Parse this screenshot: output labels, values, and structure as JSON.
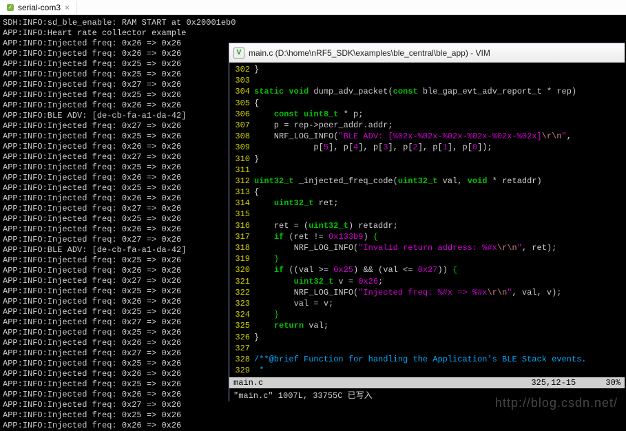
{
  "tab": {
    "title": "serial-com3",
    "close": "×"
  },
  "terminal": {
    "lines": [
      "SDH:INFO:sd_ble_enable: RAM START at 0x20001eb0",
      "APP:INFO:Heart rate collector example",
      "APP:INFO:Injected freq: 0x26 => 0x26",
      "APP:INFO:Injected freq: 0x26 => 0x26",
      "APP:INFO:Injected freq: 0x25 => 0x26",
      "APP:INFO:Injected freq: 0x25 => 0x26",
      "APP:INFO:Injected freq: 0x27 => 0x26",
      "APP:INFO:Injected freq: 0x25 => 0x26",
      "APP:INFO:Injected freq: 0x26 => 0x26",
      "APP:INFO:BLE ADV: [de-cb-fa-a1-da-42]",
      "APP:INFO:Injected freq: 0x27 => 0x26",
      "APP:INFO:Injected freq: 0x25 => 0x26",
      "APP:INFO:Injected freq: 0x26 => 0x26",
      "APP:INFO:Injected freq: 0x27 => 0x26",
      "APP:INFO:Injected freq: 0x25 => 0x26",
      "APP:INFO:Injected freq: 0x26 => 0x26",
      "APP:INFO:Injected freq: 0x25 => 0x26",
      "APP:INFO:Injected freq: 0x26 => 0x26",
      "APP:INFO:Injected freq: 0x27 => 0x26",
      "APP:INFO:Injected freq: 0x25 => 0x26",
      "APP:INFO:Injected freq: 0x26 => 0x26",
      "APP:INFO:Injected freq: 0x27 => 0x26",
      "APP:INFO:BLE ADV: [de-cb-fa-a1-da-42]",
      "APP:INFO:Injected freq: 0x25 => 0x26",
      "APP:INFO:Injected freq: 0x26 => 0x26",
      "APP:INFO:Injected freq: 0x27 => 0x26",
      "APP:INFO:Injected freq: 0x25 => 0x26",
      "APP:INFO:Injected freq: 0x26 => 0x26",
      "APP:INFO:Injected freq: 0x25 => 0x26",
      "APP:INFO:Injected freq: 0x27 => 0x26",
      "APP:INFO:Injected freq: 0x25 => 0x26",
      "APP:INFO:Injected freq: 0x26 => 0x26",
      "APP:INFO:Injected freq: 0x27 => 0x26",
      "APP:INFO:Injected freq: 0x25 => 0x26",
      "APP:INFO:Injected freq: 0x26 => 0x26",
      "APP:INFO:Injected freq: 0x25 => 0x26",
      "APP:INFO:Injected freq: 0x26 => 0x26",
      "APP:INFO:Injected freq: 0x27 => 0x26",
      "APP:INFO:Injected freq: 0x25 => 0x26",
      "APP:INFO:Injected freq: 0x26 => 0x26"
    ]
  },
  "vim": {
    "title": "main.c (D:\\home\\nRF5_SDK\\examples\\ble_central\\ble_app) - VIM",
    "status_left": "main.c",
    "status_pos": "325,12-15",
    "status_pct": "30%",
    "cmdline": "\"main.c\" 1007L, 33755C 已写入",
    "lines": [
      {
        "n": 302,
        "html": "}"
      },
      {
        "n": 303,
        "html": ""
      },
      {
        "n": 304,
        "html": "<span class='kw'>static</span> <span class='kw'>void</span> dump_adv_packet(<span class='kw'>const</span> ble_gap_evt_adv_report_t * rep)"
      },
      {
        "n": 305,
        "html": "{"
      },
      {
        "n": 306,
        "html": "    <span class='kw'>const</span> <span class='type'>uint8_t</span> * p;"
      },
      {
        "n": 307,
        "html": "    p = rep-&gt;peer_addr.addr;"
      },
      {
        "n": 308,
        "html": "    NRF_LOG_INFO(<span class='str'>\"BLE ADV: [%02x-%02x-%02x-%02x-%02x-%02x]</span><span class='esc'>\\r\\n</span><span class='str'>\"</span>,"
      },
      {
        "n": 309,
        "html": "            p[<span class='num'>5</span>], p[<span class='num'>4</span>], p[<span class='num'>3</span>], p[<span class='num'>2</span>], p[<span class='num'>1</span>], p[<span class='num'>0</span>]);"
      },
      {
        "n": 310,
        "html": "}"
      },
      {
        "n": 311,
        "html": ""
      },
      {
        "n": 312,
        "html": "<span class='type'>uint32_t</span> _injected_freq_code(<span class='type'>uint32_t</span> val, <span class='kw'>void</span> * retaddr)"
      },
      {
        "n": 313,
        "html": "{"
      },
      {
        "n": 314,
        "html": "    <span class='type'>uint32_t</span> ret;"
      },
      {
        "n": 315,
        "html": ""
      },
      {
        "n": 316,
        "html": "    ret = (<span class='type'>uint32_t</span>) retaddr;"
      },
      {
        "n": 317,
        "html": "    <span class='kw'>if</span> (ret != <span class='num'>0x133b9</span>) <span class='br'>{</span>"
      },
      {
        "n": 318,
        "html": "        NRF_LOG_INFO(<span class='str'>\"Invalid return address: %#x</span><span class='esc'>\\r\\n</span><span class='str'>\"</span>, ret);"
      },
      {
        "n": 319,
        "html": "    <span class='br'>}</span>"
      },
      {
        "n": 320,
        "html": "    <span class='kw'>if</span> ((val &gt;= <span class='num'>0x25</span>) &amp;&amp; (val &lt;= <span class='num'>0x27</span>)) <span class='br'>{</span>"
      },
      {
        "n": 321,
        "html": "        <span class='type'>uint32_t</span> v = <span class='num'>0x26</span>;"
      },
      {
        "n": 322,
        "html": "        NRF_LOG_INFO(<span class='str'>\"Injected freq: %#x =&gt; %#x</span><span class='esc'>\\r\\n</span><span class='str'>\"</span>, val, v);"
      },
      {
        "n": 323,
        "html": "        val = v;"
      },
      {
        "n": 324,
        "html": "    <span class='br'>}</span>"
      },
      {
        "n": 325,
        "html": "    <span class='kw'>return</span> val;"
      },
      {
        "n": 326,
        "html": "}"
      },
      {
        "n": 327,
        "html": ""
      },
      {
        "n": 328,
        "html": "<span class='cmt'>/**@brief Function for handling the Application's BLE Stack events.</span>"
      },
      {
        "n": 329,
        "html": "<span class='cmt'> *</span>"
      }
    ]
  },
  "watermark": "http://blog.csdn.net/"
}
